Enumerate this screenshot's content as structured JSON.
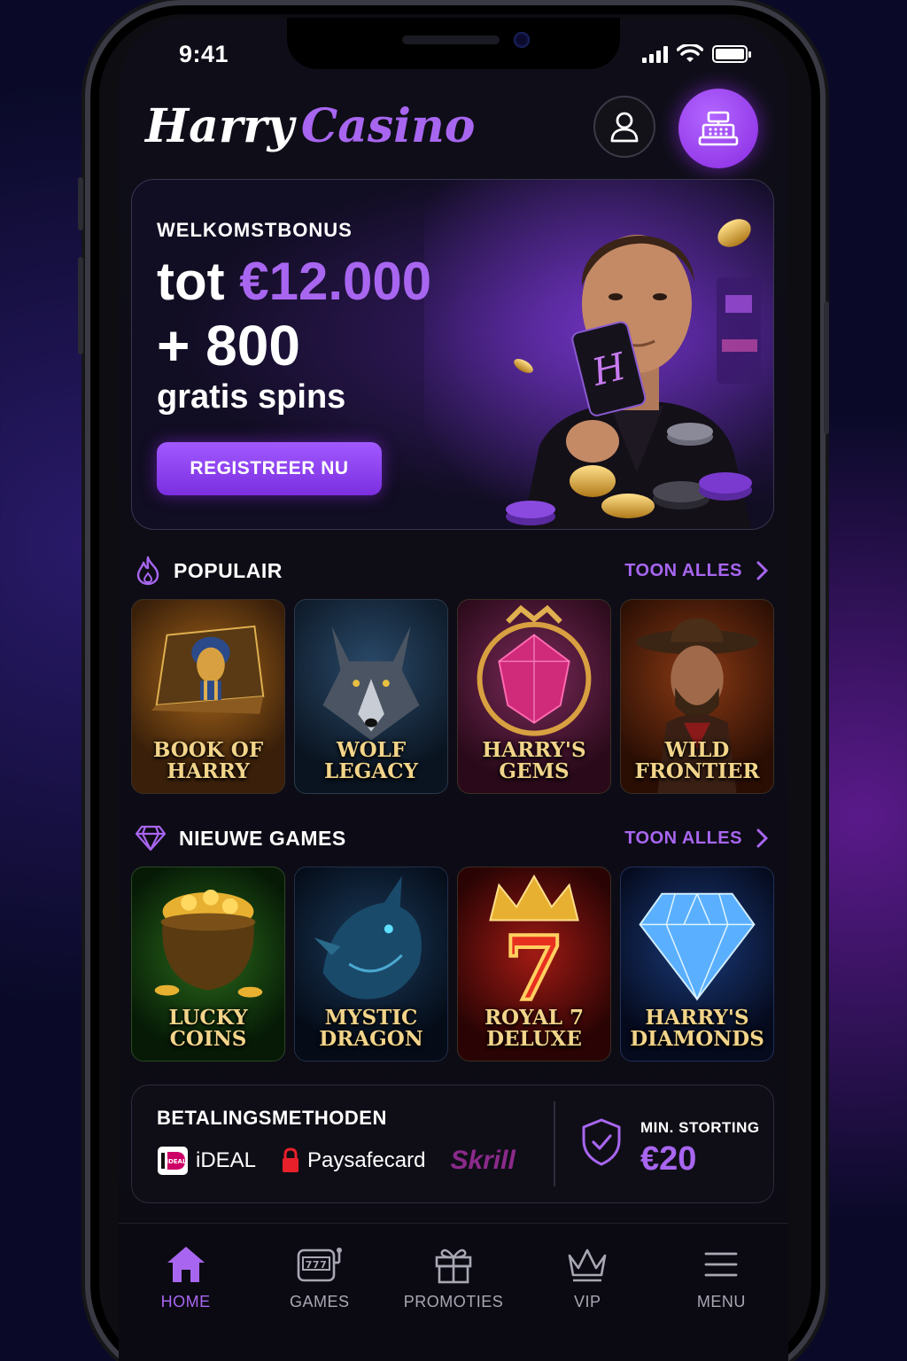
{
  "status_bar": {
    "time": "9:41"
  },
  "header": {
    "logo_part1": "Harry",
    "logo_part2": "Casino",
    "profile_icon": "user-icon",
    "cashier_icon": "cash-register-icon"
  },
  "hero": {
    "kicker": "WELKOMSTBONUS",
    "line1_prefix": "tot ",
    "line1_amount": "€12.000",
    "line2": "+ 800",
    "line3": "gratis spins",
    "cta_label": "REGISTREER NU",
    "card_letter": "H"
  },
  "sections": {
    "popular": {
      "title": "POPULAIR",
      "icon": "flame-icon",
      "show_all": "TOON ALLES",
      "games": [
        {
          "name": "Book of Harry"
        },
        {
          "name": "Wolf Legacy"
        },
        {
          "name": "Harry's Gems"
        },
        {
          "name": "Wild Frontier"
        }
      ]
    },
    "new_games": {
      "title": "NIEUWE GAMES",
      "icon": "diamond-icon",
      "show_all": "TOON ALLES",
      "games": [
        {
          "name": "Lucky Coins"
        },
        {
          "name": "Mystic Dragon"
        },
        {
          "name": "Royal 7 Deluxe"
        },
        {
          "name": "Harry's Diamonds"
        }
      ]
    }
  },
  "payments": {
    "title": "BETALINGSMETHODEN",
    "methods": [
      "iDEAL",
      "Paysafecard",
      "Skrill"
    ],
    "ideal_badge": "iDEAL",
    "min_deposit_label": "MIN. STORTING",
    "min_deposit_value": "€20"
  },
  "tabbar": {
    "items": [
      {
        "label": "HOME",
        "icon": "home-icon",
        "active": true
      },
      {
        "label": "GAMES",
        "icon": "slot-machine-icon",
        "active": false
      },
      {
        "label": "PROMOTIES",
        "icon": "gift-icon",
        "active": false
      },
      {
        "label": "VIP",
        "icon": "crown-icon",
        "active": false
      },
      {
        "label": "MENU",
        "icon": "hamburger-menu-icon",
        "active": false
      }
    ]
  },
  "colors": {
    "accent": "#a866f0",
    "background": "#0c0b14",
    "gold_text": "#f2d48a"
  }
}
